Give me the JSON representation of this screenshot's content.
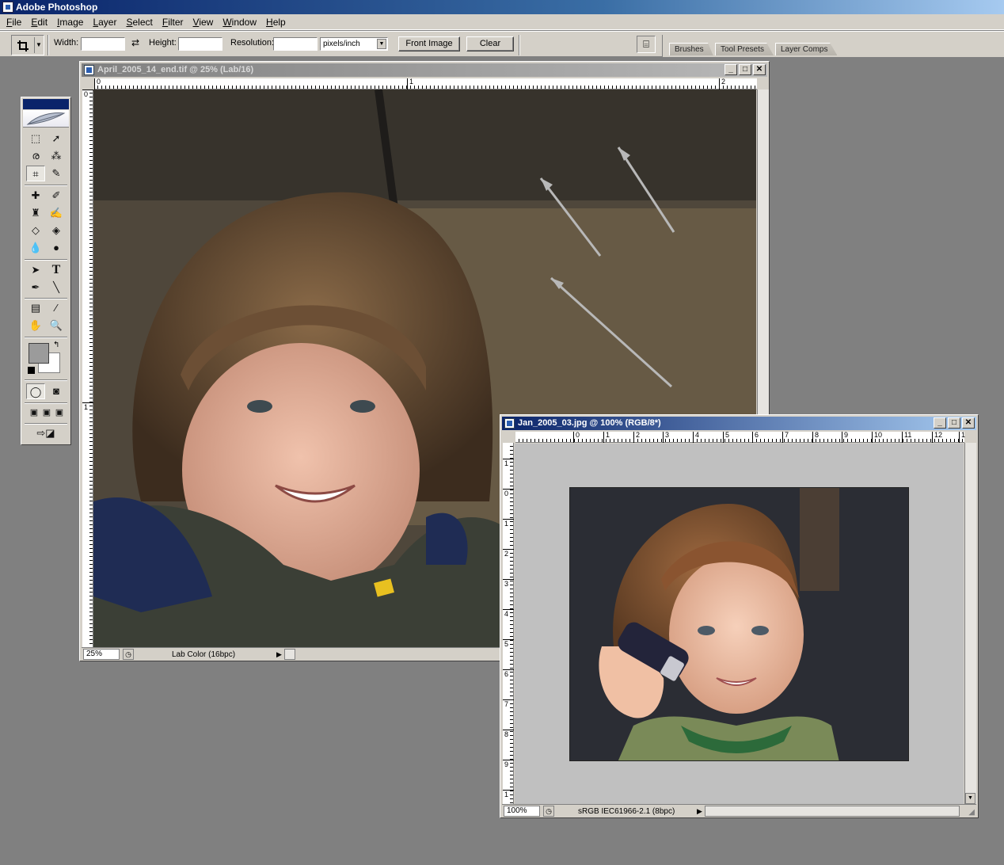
{
  "app": {
    "title": "Adobe Photoshop"
  },
  "menu": [
    "File",
    "Edit",
    "Image",
    "Layer",
    "Select",
    "Filter",
    "View",
    "Window",
    "Help"
  ],
  "options": {
    "width_label": "Width:",
    "width_value": "",
    "height_label": "Height:",
    "height_value": "",
    "resolution_label": "Resolution:",
    "resolution_value": "",
    "units": "pixels/inch",
    "front_image": "Front Image",
    "clear": "Clear"
  },
  "palette_well": {
    "tabs": [
      "Brushes",
      "Tool Presets",
      "Layer Comps"
    ]
  },
  "toolbox": {
    "tools": [
      "marquee-icon",
      "move-icon",
      "lasso-icon",
      "magic-wand-icon",
      "crop-icon",
      "slice-icon",
      "healing-brush-icon",
      "brush-icon",
      "clone-stamp-icon",
      "history-brush-icon",
      "eraser-icon",
      "paint-bucket-icon",
      "blur-icon",
      "dodge-icon",
      "path-select-icon",
      "type-icon",
      "pen-icon",
      "line-icon",
      "notes-icon",
      "eyedropper-icon",
      "hand-icon",
      "zoom-icon"
    ],
    "foreground_color": "#9b9b9b",
    "background_color": "#ffffff"
  },
  "doc1": {
    "title": "April_2005_14_end.tif @ 25% (Lab/16)",
    "zoom": "25%",
    "info": "Lab Color (16bpc)",
    "ruler_h": [
      "0",
      "1",
      "2"
    ],
    "ruler_v": [
      "0",
      "1"
    ]
  },
  "doc2": {
    "title": "Jan_2005_03.jpg @ 100% (RGB/8*)",
    "zoom": "100%",
    "info": "sRGB IEC61966-2.1 (8bpc)",
    "ruler_h": [
      "0",
      "1",
      "2",
      "3",
      "4",
      "5",
      "6",
      "7",
      "8",
      "9",
      "10",
      "11",
      "12",
      "1"
    ],
    "ruler_v": [
      "1",
      "0",
      "1",
      "2",
      "3",
      "4",
      "5",
      "6",
      "7",
      "8",
      "9",
      "1"
    ]
  }
}
